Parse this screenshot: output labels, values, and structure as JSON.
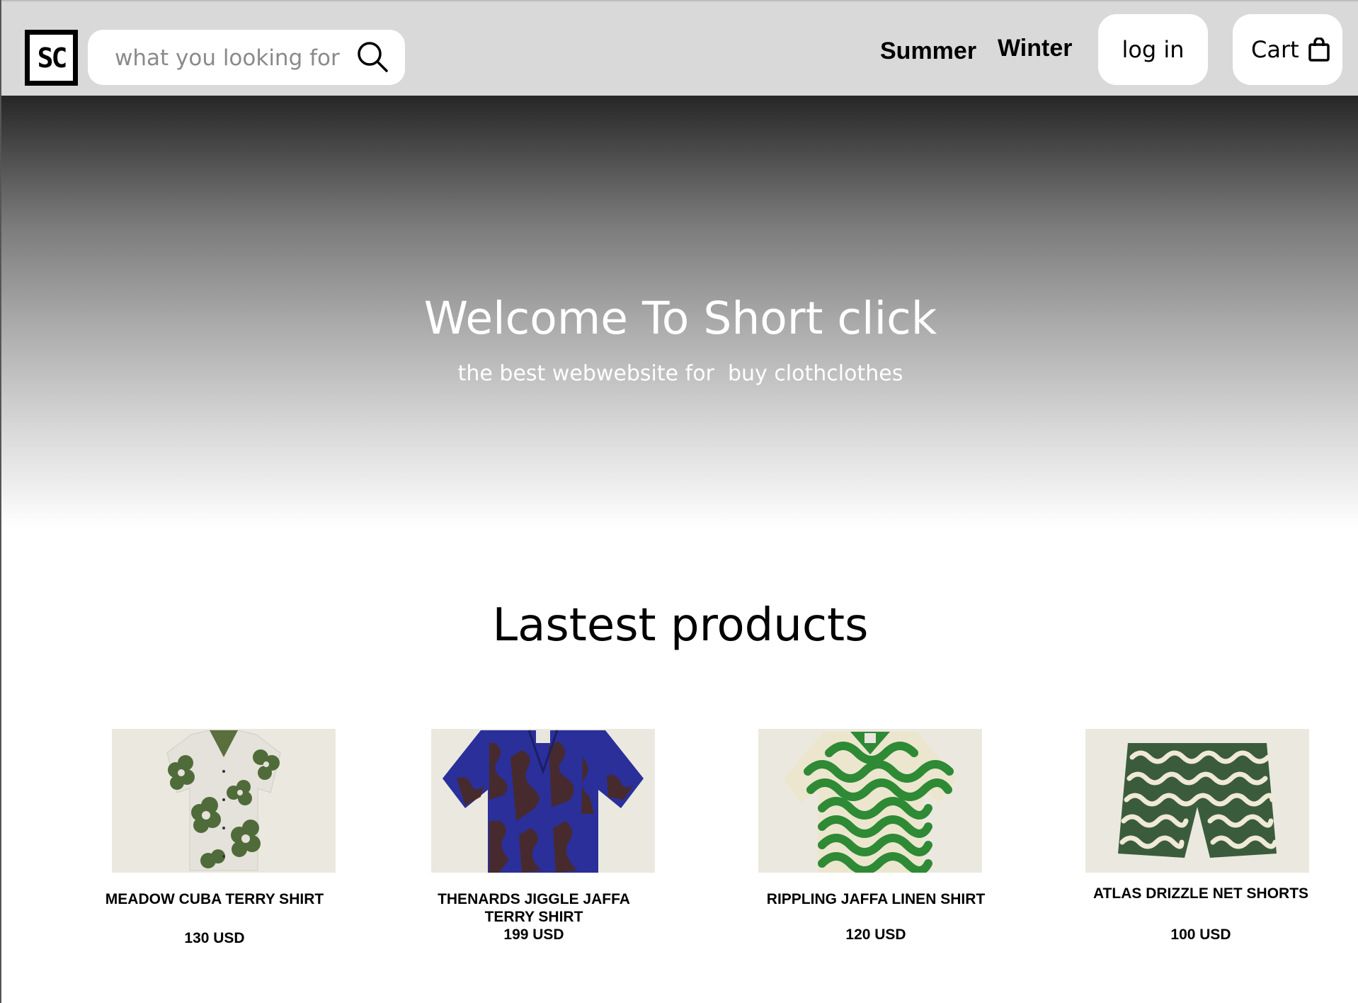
{
  "header": {
    "logo_text": "SC",
    "search": {
      "placeholder": "what you looking for",
      "icon": "search-icon"
    },
    "nav": [
      {
        "label": "Summer"
      },
      {
        "label": "Winter"
      }
    ],
    "login_label": "log in",
    "cart_label": "Cart",
    "cart_icon": "shopping-bag-icon"
  },
  "hero": {
    "title": "Welcome To Short click",
    "subtitle": "the best webwebsite for  buy clothclothes"
  },
  "products_section": {
    "title": "Lastest products",
    "products": [
      {
        "name": "MEADOW CUBA TERRY SHIRT",
        "price": "130 USD",
        "pattern_color": "#4f6b3a",
        "base_color": "#e8e6de"
      },
      {
        "name": "THENARDS JIGGLE JAFFA TERRY SHIRT",
        "price": "199 USD",
        "pattern_color": "#4b2a22",
        "base_color": "#2a2f9a"
      },
      {
        "name": "RIPPLING JAFFA LINEN SHIRT",
        "price": "120 USD",
        "pattern_color": "#2e8a34",
        "base_color": "#ece6cf"
      },
      {
        "name": "ATLAS DRIZZLE NET SHORTS",
        "price": "100 USD",
        "pattern_color": "#3b5c3c",
        "base_color": "#efe9d6"
      }
    ]
  }
}
